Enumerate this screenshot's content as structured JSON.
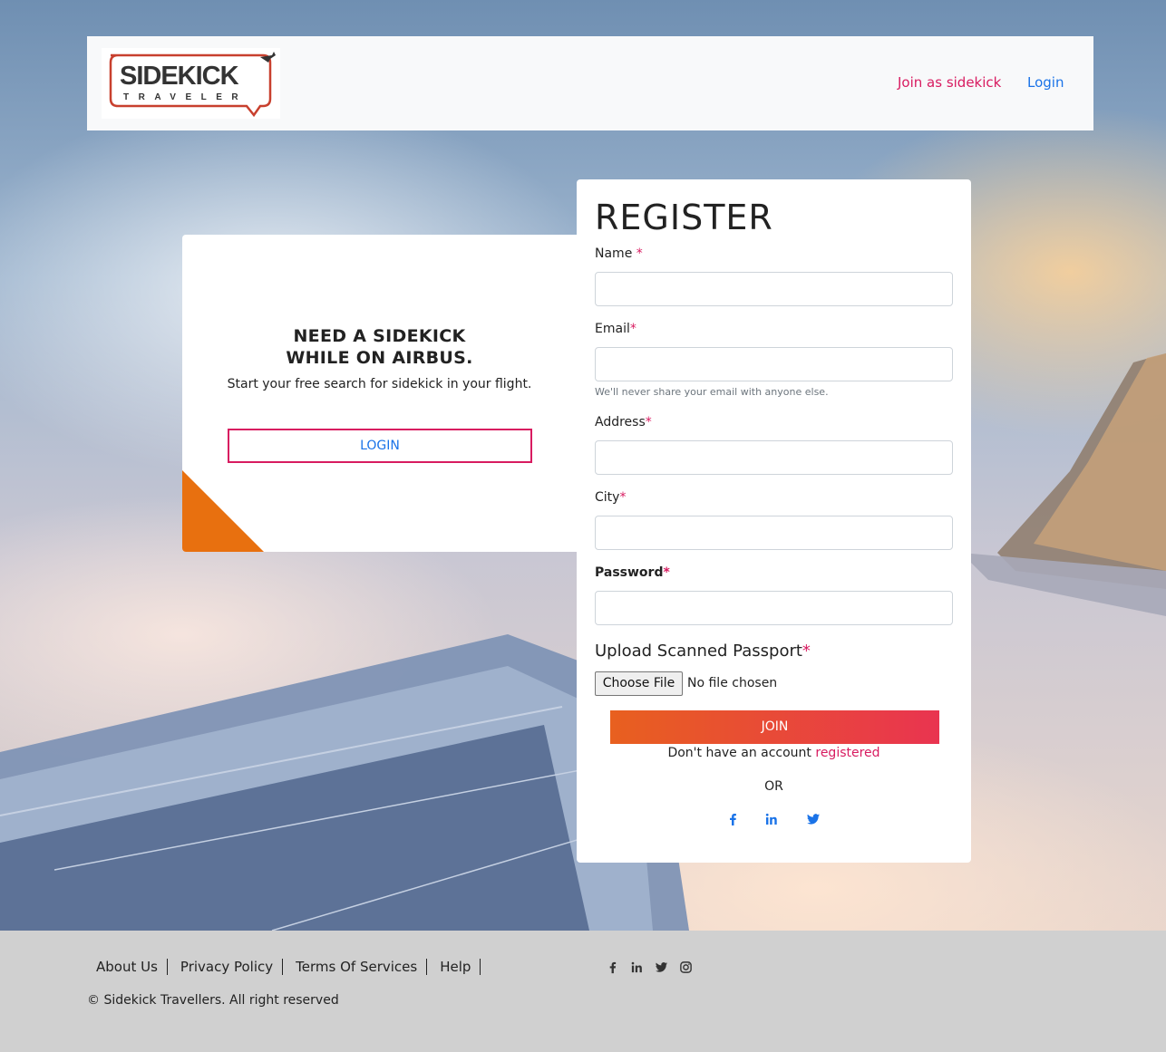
{
  "header": {
    "logo_main": "SIDEKICK",
    "logo_sub": "TRAVELER",
    "nav_join": "Join as sidekick",
    "nav_login": "Login"
  },
  "promo": {
    "title_line1": "NEED A SIDEKICK",
    "title_line2": "WHILE ON AIRBUS.",
    "subtitle": "Start your free search for sidekick in your flight.",
    "login_button": "LOGIN"
  },
  "register": {
    "title": "REGISTER",
    "fields": {
      "name_label": "Name",
      "email_label": "Email",
      "email_help": "We'll never share your email with anyone else.",
      "address_label": "Address",
      "city_label": "City",
      "password_label": "Password",
      "required_mark": "*"
    },
    "upload_label": "Upload Scanned Passport",
    "file_button": "Choose File",
    "file_status": "No file chosen",
    "join_button": "JOIN",
    "account_text": "Don't have an account",
    "account_link": "registered",
    "or_text": "OR",
    "social_icons": [
      "facebook-icon",
      "linkedin-icon",
      "twitter-icon"
    ]
  },
  "footer": {
    "links": [
      "About Us",
      "Privacy Policy",
      "Terms Of Services",
      "Help"
    ],
    "social_icons": [
      "facebook-icon",
      "linkedin-icon",
      "twitter-icon",
      "instagram-icon"
    ],
    "copyright": "© Sidekick Travellers. All right reserved"
  },
  "colors": {
    "accent_pink": "#d81b60",
    "link_blue": "#1a73e8",
    "orange": "#e8700f",
    "join_gradient_start": "#e8601f",
    "join_gradient_end": "#e93450"
  }
}
